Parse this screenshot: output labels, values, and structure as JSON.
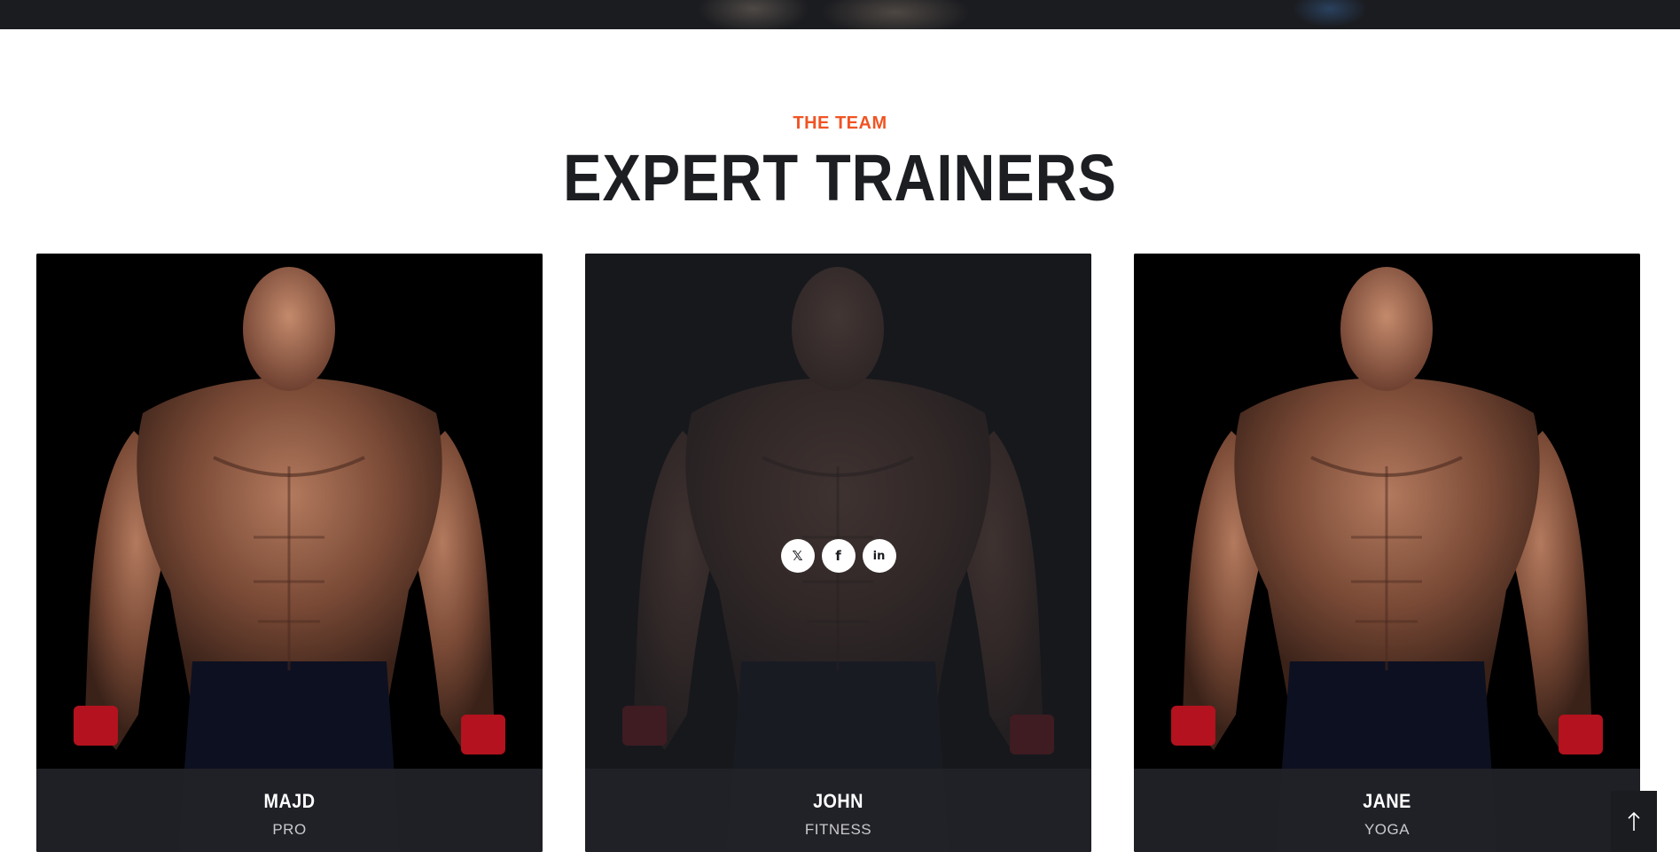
{
  "header": {
    "kicker": "THE TEAM",
    "title": "EXPERT TRAINERS"
  },
  "trainers": [
    {
      "name": "MAJD",
      "role": "PRO"
    },
    {
      "name": "JOHN",
      "role": "FITNESS"
    },
    {
      "name": "JANE",
      "role": "YOGA"
    }
  ],
  "social": [
    {
      "icon": "twitter-icon",
      "glyph": "𝕏"
    },
    {
      "icon": "facebook-icon",
      "glyph": "f"
    },
    {
      "icon": "linkedin-icon",
      "glyph": "in"
    }
  ],
  "colors": {
    "accent": "#f05423",
    "dark": "#1b1c20",
    "title": "#1d1e22"
  }
}
